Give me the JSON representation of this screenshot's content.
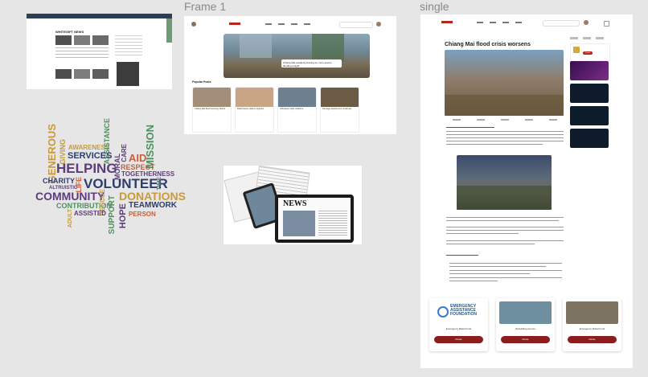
{
  "frames": {
    "frame1_label": "Frame 1",
    "single_label": "single"
  },
  "news_site": {
    "brand": "WHITEGIFT NEWS"
  },
  "frame1": {
    "hero_caption": "Chiang Mai residents bracing for more severe flooding tonight",
    "section_title": "Popular Posts",
    "cards": [
      {
        "caption": "Chiang Mai flood recovery efforts",
        "color": "#a38f79"
      },
      {
        "caption": "Relief teams deliver supplies",
        "color": "#c9a485"
      },
      {
        "caption": "Volunteers help residents",
        "color": "#6e7f8e"
      },
      {
        "caption": "Damage assessment continues",
        "color": "#6b5a44"
      }
    ]
  },
  "single": {
    "article_title": "Chiang Mai flood crisis worsens",
    "side_button": "Donate",
    "donation_cards": [
      {
        "name": "Emergency Relief Fund",
        "button": "Donate",
        "color": "#ffffff",
        "org_line1": "EMERGENCY",
        "org_line2": "ASSISTANCE",
        "org_line3": "FOUNDATION"
      },
      {
        "name": "Rebuilding Homes",
        "button": "Donate",
        "color": "#6e8fa0"
      },
      {
        "name": "Emergency Relief Fund",
        "button": "Donate",
        "color": "#7c7460"
      }
    ]
  },
  "word_cloud": {
    "words": [
      {
        "text": "GENEROUS",
        "color": "#c89a3d"
      },
      {
        "text": "GIVING",
        "color": "#c89a3d"
      },
      {
        "text": "AWARENESS",
        "color": "#c89a3d"
      },
      {
        "text": "ASSISTANCE",
        "color": "#4f8f5f"
      },
      {
        "text": "SERVICES",
        "color": "#2d3d6e"
      },
      {
        "text": "CARE",
        "color": "#5c3d7a"
      },
      {
        "text": "MISSION",
        "color": "#4f8f5f"
      },
      {
        "text": "HELPING",
        "color": "#5c3d7a"
      },
      {
        "text": "MORAL",
        "color": "#5c3d7a"
      },
      {
        "text": "AID",
        "color": "#c9603d"
      },
      {
        "text": "RESPECT",
        "color": "#c9603d"
      },
      {
        "text": "TOGETHERNESS",
        "color": "#5c3d7a"
      },
      {
        "text": "CHARITY",
        "color": "#2d3d6e"
      },
      {
        "text": "LIFE",
        "color": "#c9603d"
      },
      {
        "text": "VOLUNTEER",
        "color": "#2d3d6e"
      },
      {
        "text": "TIME",
        "color": "#4f8f5f"
      },
      {
        "text": "ALTRUISTIC",
        "color": "#5c3d7a"
      },
      {
        "text": "COMMUNITY",
        "color": "#5c3d7a"
      },
      {
        "text": "DONATIONS",
        "color": "#c89a3d"
      },
      {
        "text": "CONTRIBUTION",
        "color": "#4f8f5f"
      },
      {
        "text": "RESCUE",
        "color": "#c89a3d"
      },
      {
        "text": "TEAMWORK",
        "color": "#2d3d6e"
      },
      {
        "text": "ADULT",
        "color": "#c89a3d"
      },
      {
        "text": "ASSISTED",
        "color": "#5c3d7a"
      },
      {
        "text": "SUPPORT",
        "color": "#4f8f5f"
      },
      {
        "text": "HOPE",
        "color": "#5c3d7a"
      },
      {
        "text": "PERSON",
        "color": "#c9603d"
      }
    ]
  },
  "newspapers": {
    "masthead": "NEWS"
  }
}
